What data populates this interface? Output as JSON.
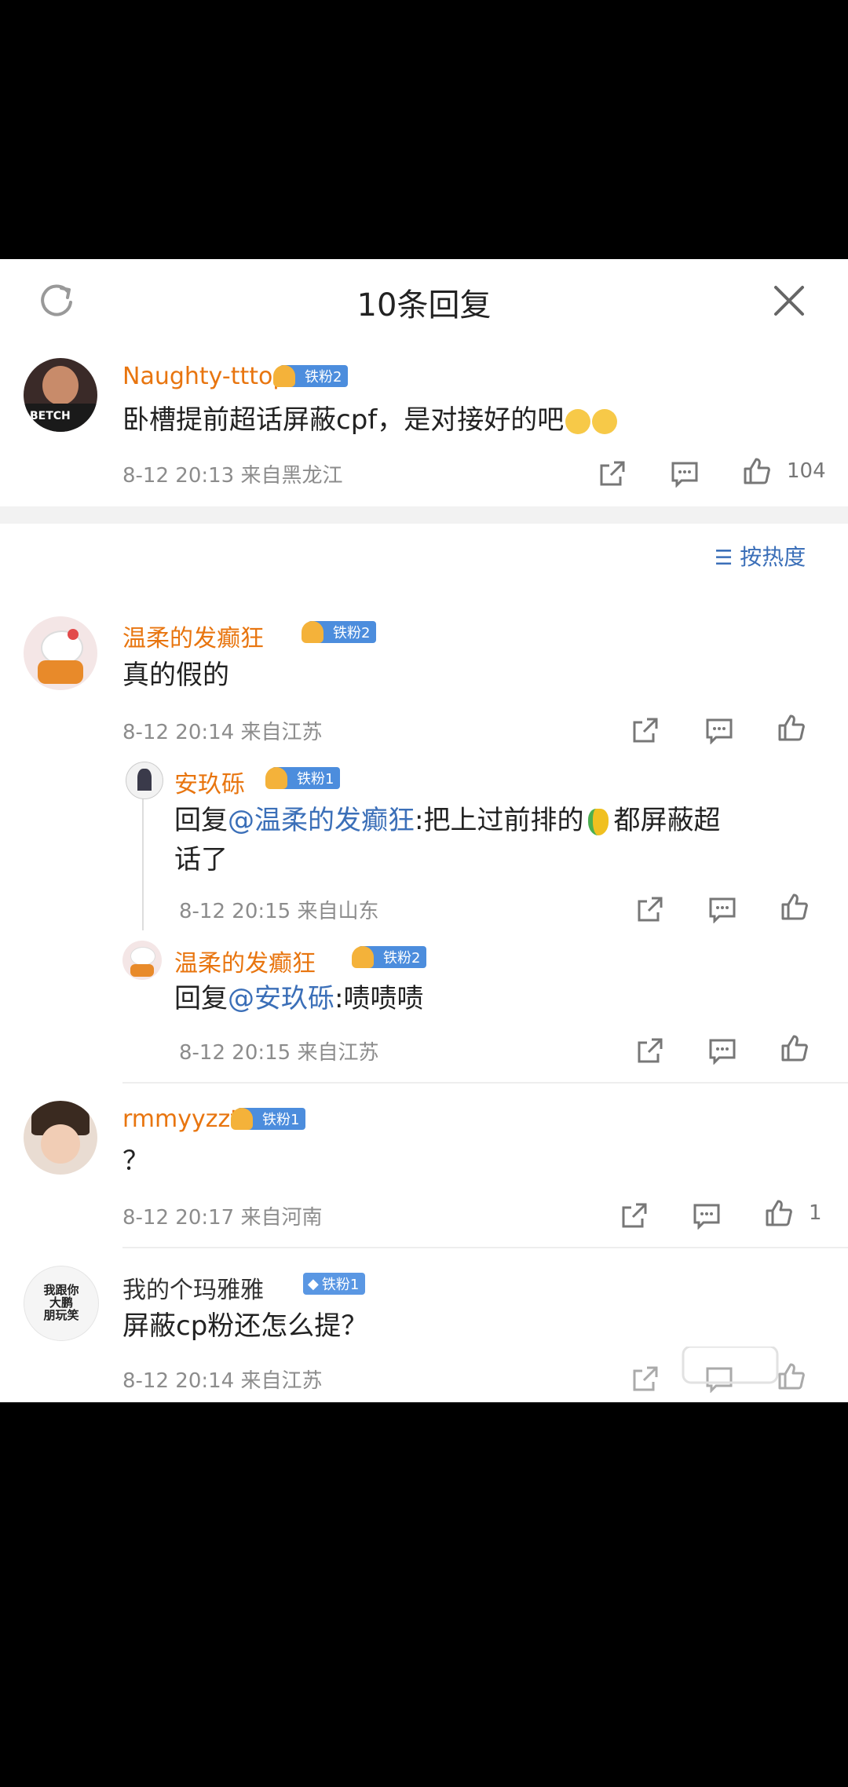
{
  "header": {
    "title": "10条回复"
  },
  "main_comment": {
    "user": "Naughty-tttop",
    "badge": "铁粉2",
    "text": "卧槽提前超话屏蔽cpf，是对接好的吧",
    "time": "8-12 20:13 来自黑龙江",
    "likes": "104"
  },
  "sort_label": "按热度",
  "replies": [
    {
      "user": "温柔的发癫狂",
      "badge": "铁粉2",
      "text": "真的假的",
      "time": "8-12 20:14 来自江苏"
    },
    {
      "user": "安玖砾",
      "badge": "铁粉1",
      "reply_prefix": "回复",
      "reply_to": "@温柔的发癫狂",
      "text_a": ":把上过前排的",
      "text_b": "都屏蔽超",
      "text_c": "话了",
      "time": "8-12 20:15 来自山东"
    },
    {
      "user": "温柔的发癫狂",
      "badge": "铁粉2",
      "reply_prefix": "回复",
      "reply_to": "@安玖砾",
      "text": ":啧啧啧",
      "time": "8-12 20:15 来自江苏"
    },
    {
      "user": "rmmyyzzt",
      "badge": "铁粉1",
      "text": "？",
      "time": "8-12 20:17 来自河南",
      "likes": "1"
    },
    {
      "user": "我的个玛雅雅",
      "badge": "铁粉1",
      "text": "屏蔽cp粉还怎么提？",
      "time": "8-12 20:14 来自江苏"
    }
  ],
  "colors": {
    "accent": "#3b6fb8",
    "name_orange": "#e8750f",
    "badge": "#4c8ddd"
  }
}
